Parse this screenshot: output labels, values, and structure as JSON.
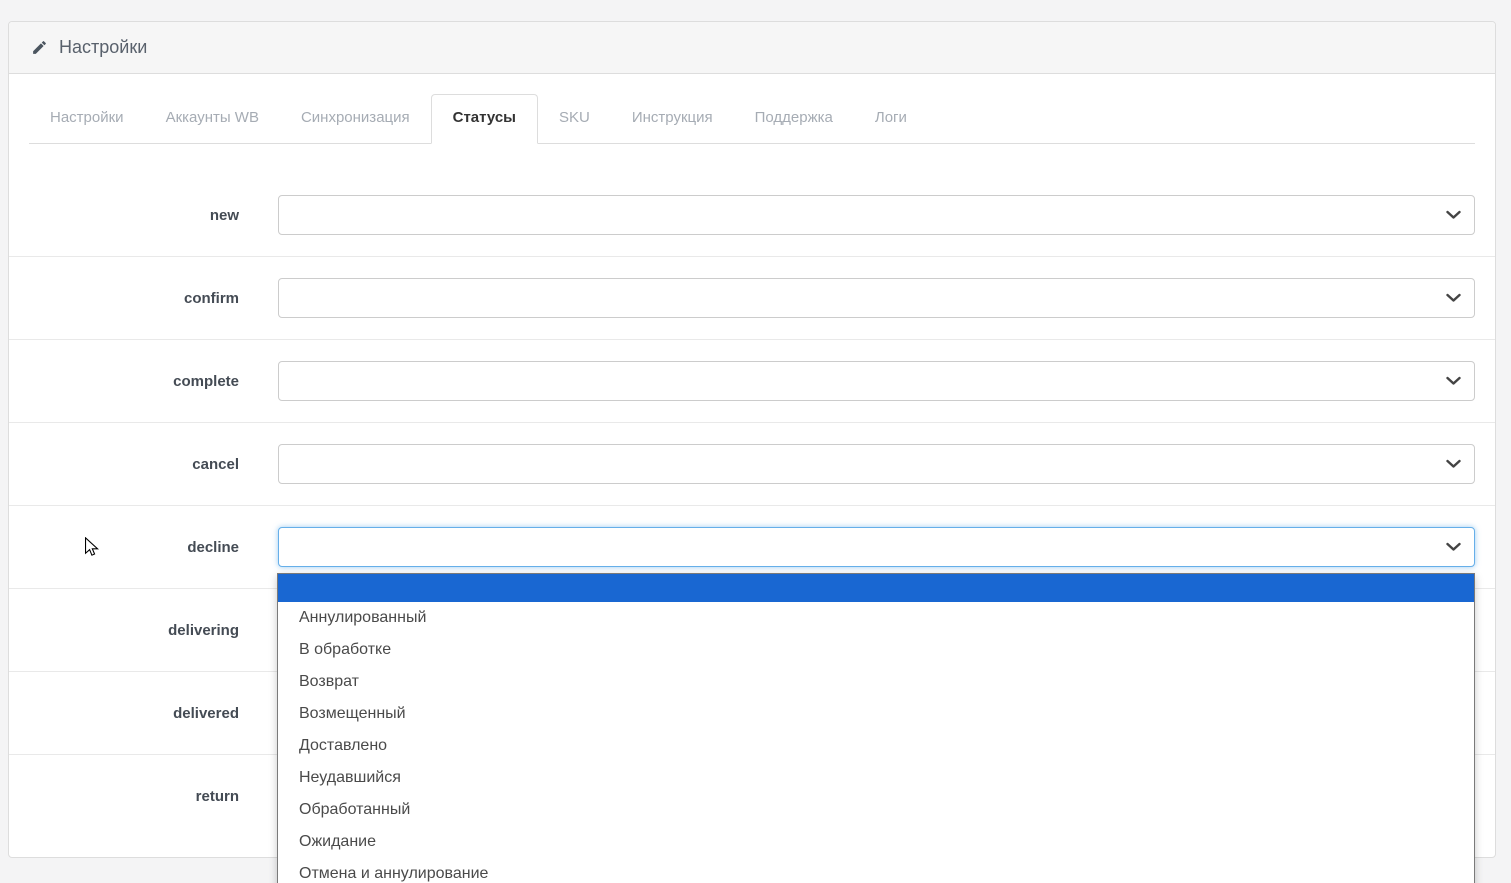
{
  "header": {
    "title": "Настройки",
    "icon": "pencil-icon"
  },
  "tabs": [
    {
      "name": "settings",
      "label": "Настройки",
      "active": false
    },
    {
      "name": "accounts-wb",
      "label": "Аккаунты WB",
      "active": false
    },
    {
      "name": "synchronization",
      "label": "Синхронизация",
      "active": false
    },
    {
      "name": "statuses",
      "label": "Статусы",
      "active": true
    },
    {
      "name": "sku",
      "label": "SKU",
      "active": false
    },
    {
      "name": "instruction",
      "label": "Инструкция",
      "active": false
    },
    {
      "name": "support",
      "label": "Поддержка",
      "active": false
    },
    {
      "name": "logs",
      "label": "Логи",
      "active": false
    }
  ],
  "form": {
    "rows": [
      {
        "label": "new",
        "value": "",
        "focused": false,
        "dropdown_open": false
      },
      {
        "label": "confirm",
        "value": "",
        "focused": false,
        "dropdown_open": false
      },
      {
        "label": "complete",
        "value": "",
        "focused": false,
        "dropdown_open": false
      },
      {
        "label": "cancel",
        "value": "",
        "focused": false,
        "dropdown_open": false
      },
      {
        "label": "decline",
        "value": "",
        "focused": true,
        "dropdown_open": true
      },
      {
        "label": "delivering",
        "value": "",
        "focused": false,
        "dropdown_open": false
      },
      {
        "label": "delivered",
        "value": "",
        "focused": false,
        "dropdown_open": false
      },
      {
        "label": "return",
        "value": "",
        "focused": false,
        "dropdown_open": false
      }
    ]
  },
  "dropdown": {
    "selected_value": "",
    "options": [
      "Аннулированный",
      "В обработке",
      "Возврат",
      "Возмещенный",
      "Доставлено",
      "Неудавшийся",
      "Обработанный",
      "Ожидание",
      "Отмена и аннулирование"
    ]
  },
  "colors": {
    "highlight_blue": "#1967d2",
    "focus_border": "#66afe9",
    "panel_border": "#dddddd",
    "tab_inactive": "#a6acb4",
    "heading_text": "#59616c"
  }
}
